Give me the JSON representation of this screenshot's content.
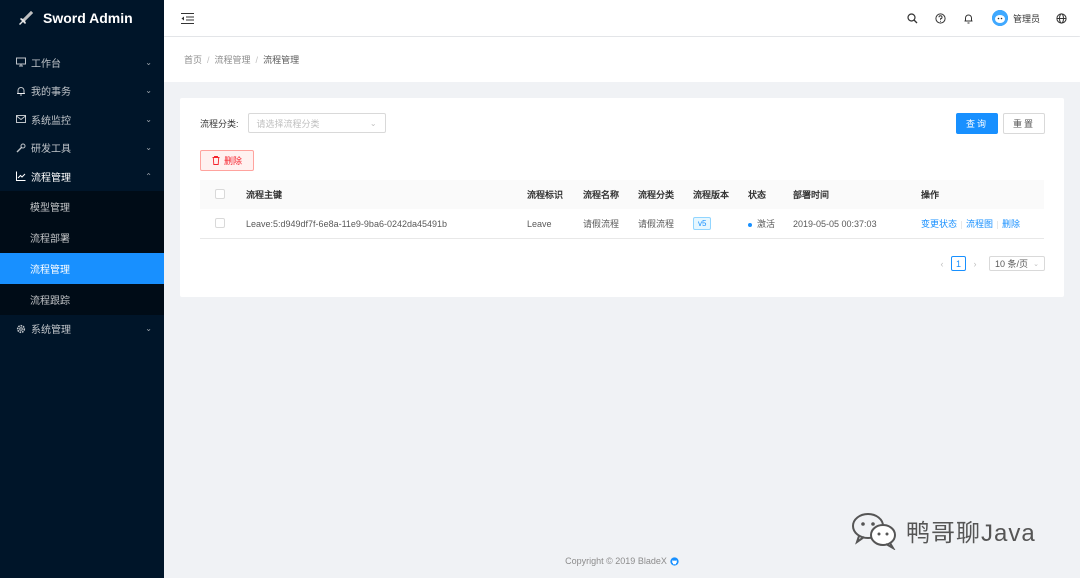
{
  "app": {
    "title": "Sword Admin"
  },
  "sidebar": {
    "items": [
      {
        "label": "工作台",
        "icon": "monitor-icon"
      },
      {
        "label": "我的事务",
        "icon": "bell-icon"
      },
      {
        "label": "系统监控",
        "icon": "mail-icon"
      },
      {
        "label": "研发工具",
        "icon": "tool-icon"
      },
      {
        "label": "流程管理",
        "icon": "line-chart-icon",
        "expanded": true,
        "children": [
          {
            "label": "模型管理"
          },
          {
            "label": "流程部署"
          },
          {
            "label": "流程管理",
            "active": true
          },
          {
            "label": "流程跟踪"
          }
        ]
      },
      {
        "label": "系统管理",
        "icon": "gear-icon"
      }
    ]
  },
  "header": {
    "username": "管理员"
  },
  "breadcrumb": [
    "首页",
    "流程管理",
    "流程管理"
  ],
  "filter": {
    "label": "流程分类:",
    "placeholder": "请选择流程分类"
  },
  "buttons": {
    "search": "查询",
    "reset": "重置",
    "delete": "删除"
  },
  "table": {
    "columns": [
      "流程主键",
      "流程标识",
      "流程名称",
      "流程分类",
      "流程版本",
      "状态",
      "部署时间",
      "操作"
    ],
    "rows": [
      {
        "key": "Leave:5:d949df7f-6e8a-11e9-9ba6-0242da45491b",
        "id": "Leave",
        "name": "请假流程",
        "category": "请假流程",
        "version": "v5",
        "state": "激活",
        "time": "2019-05-05 00:37:03",
        "ops": [
          "变更状态",
          "流程图",
          "删除"
        ]
      }
    ]
  },
  "pagination": {
    "current": "1",
    "page_size": "10 条/页"
  },
  "footer": {
    "copyright": "Copyright © 2019 BladeX"
  },
  "watermark": {
    "text": "鸭哥聊Java"
  },
  "colors": {
    "sidebar_bg": "#001529",
    "accent": "#1890ff",
    "danger": "#f5222d"
  }
}
